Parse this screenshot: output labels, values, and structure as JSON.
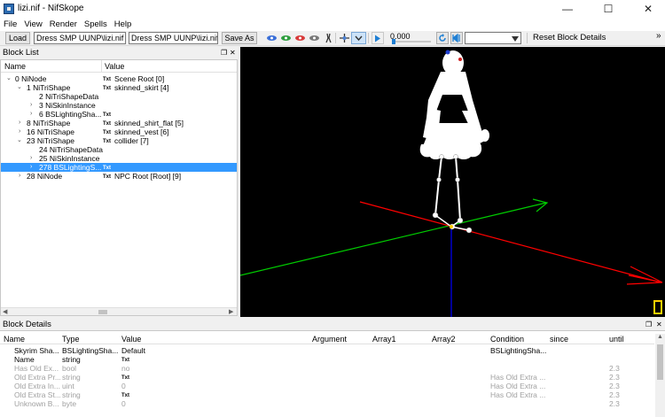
{
  "window": {
    "title": "lizi.nif - NifSkope",
    "minimize": "—",
    "maximize": "☐",
    "close": "✕"
  },
  "menu": [
    "File",
    "View",
    "Render",
    "Spells",
    "Help"
  ],
  "toolbar": {
    "load_label": "Load",
    "load_path": "Dress SMP UUNP\\lizi.nif",
    "save_path": "Dress SMP UUNP\\lizi.nif",
    "saveas_label": "Save As",
    "time": "0.000",
    "reset_label": "Reset Block Details",
    "overflow": "»"
  },
  "blocklist": {
    "title": "Block List",
    "col_name": "Name",
    "col_value": "Value",
    "rows": [
      {
        "arrow": "⌄",
        "name": "0 NiNode",
        "txt": "Txt",
        "value": "Scene Root [0]"
      },
      {
        "arrow": "⌄",
        "name": "1 NiTriShape",
        "txt": "Txt",
        "value": "skinned_skirt [4]"
      },
      {
        "arrow": "",
        "name": "2 NiTriShapeData",
        "txt": "",
        "value": ""
      },
      {
        "arrow": "›",
        "name": "3 NiSkinInstance",
        "txt": "",
        "value": ""
      },
      {
        "arrow": "›",
        "name": "6 BSLightingSha...",
        "txt": "Txt",
        "value": ""
      },
      {
        "arrow": "›",
        "name": "8 NiTriShape",
        "txt": "Txt",
        "value": "skinned_shirt_flat [5]"
      },
      {
        "arrow": "›",
        "name": "16 NiTriShape",
        "txt": "Txt",
        "value": "skinned_vest [6]"
      },
      {
        "arrow": "⌄",
        "name": "23 NiTriShape",
        "txt": "Txt",
        "value": "collider [7]"
      },
      {
        "arrow": "",
        "name": "24 NiTriShapeData",
        "txt": "",
        "value": ""
      },
      {
        "arrow": "›",
        "name": "25 NiSkinInstance",
        "txt": "",
        "value": ""
      },
      {
        "arrow": "›",
        "name": "278 BSLightingS...",
        "txt": "Txt",
        "value": ""
      },
      {
        "arrow": "›",
        "name": "28 NiNode",
        "txt": "Txt",
        "value": "NPC Root [Root] [9]"
      }
    ]
  },
  "details": {
    "title": "Block Details",
    "columns": [
      "Name",
      "Type",
      "Value",
      "Argument",
      "Array1",
      "Array2",
      "Condition",
      "since",
      "until"
    ],
    "rows": [
      {
        "name": "Skyrim Sha...",
        "type": "BSLightingSha...",
        "value": "Default",
        "txt": "",
        "condition": "BSLightingSha...",
        "until": "",
        "gray": false
      },
      {
        "name": "Name",
        "type": "string",
        "value": "",
        "txt": "Txt",
        "condition": "",
        "until": "",
        "gray": false
      },
      {
        "name": "Has Old Ex...",
        "type": "bool",
        "value": "no",
        "txt": "",
        "condition": "",
        "until": "2.3",
        "gray": true
      },
      {
        "name": "Old Extra Pr...",
        "type": "string",
        "value": "",
        "txt": "Txt",
        "condition": "Has Old Extra ...",
        "until": "2.3",
        "gray": true
      },
      {
        "name": "Old Extra In...",
        "type": "uint",
        "value": "0",
        "txt": "",
        "condition": "Has Old Extra ...",
        "until": "2.3",
        "gray": true
      },
      {
        "name": "Old Extra St...",
        "type": "string",
        "value": "",
        "txt": "Txt",
        "condition": "Has Old Extra ...",
        "until": "2.3",
        "gray": true
      },
      {
        "name": "Unknown B...",
        "type": "byte",
        "value": "0",
        "txt": "",
        "condition": "",
        "until": "2.3",
        "gray": true
      }
    ]
  },
  "colors": {
    "selection": "#3399ff",
    "axis_x": "#ff0000",
    "axis_y": "#00cc00",
    "axis_z": "#0000ff",
    "viewport_bg": "#000000"
  }
}
